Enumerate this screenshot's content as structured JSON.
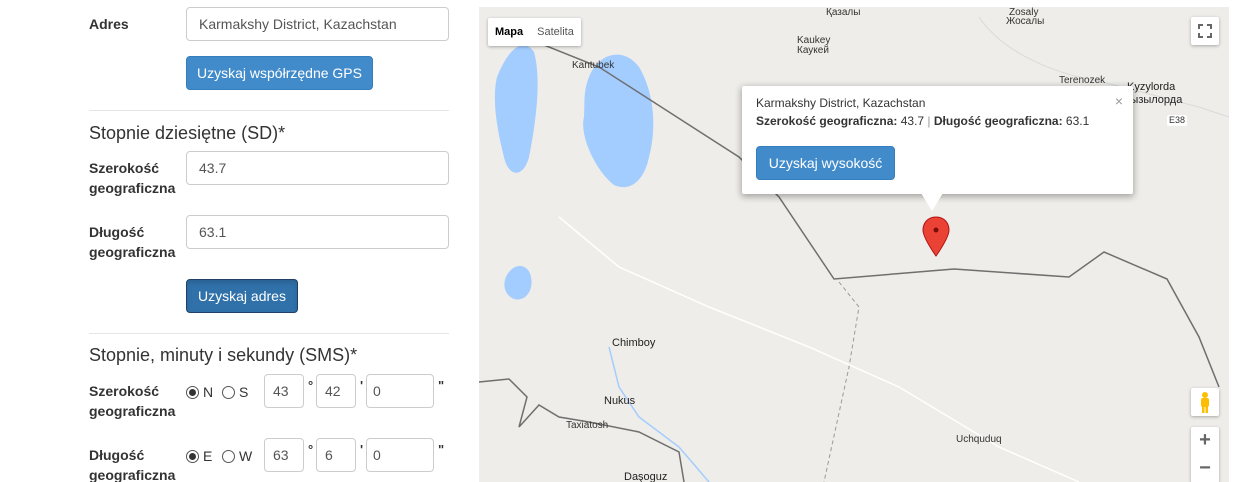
{
  "form": {
    "address_label": "Adres",
    "address_value": "Karmakshy District, Kazachstan",
    "get_gps_button": "Uzyskaj współrzędne GPS",
    "dd_heading": "Stopnie dziesiętne (SD)*",
    "lat_label": "Szerokość geograficzna",
    "lat_value": "43.7",
    "lng_label": "Długość geograficzna",
    "lng_value": "63.1",
    "get_address_button": "Uzyskaj adres",
    "dms_heading": "Stopnie, minuty i sekundy (SMS)*",
    "dms_lat_label": "Szerokość geograficzna",
    "dms_lat_dir_n": "N",
    "dms_lat_dir_s": "S",
    "dms_lat_selected": "N",
    "dms_lat_deg": "43",
    "dms_lat_min": "42",
    "dms_lat_sec": "0",
    "dms_lng_label": "Długość geograficzna",
    "dms_lng_dir_e": "E",
    "dms_lng_dir_w": "W",
    "dms_lng_selected": "E",
    "dms_lng_deg": "63",
    "dms_lng_min": "6",
    "dms_lng_sec": "0",
    "deg_symbol": "°",
    "min_symbol": "'",
    "sec_symbol": "\""
  },
  "map": {
    "type_map": "Mapa",
    "type_satellite": "Satelita",
    "zoom_in": "+",
    "zoom_out": "−",
    "places": {
      "kazaly": "Қазалы",
      "zosaly": "Zosaly",
      "zhosaly": "Жосалы",
      "kaukey": "Kaukey",
      "kaukey_cyr": "Каукей",
      "kantubek": "Kantubek",
      "terenozek": "Terenozek",
      "kyzylorda": "Kyzylorda",
      "kyzylorda_cyr": "Кызылорда",
      "e38": "E38",
      "chimboy": "Chimboy",
      "nukus": "Nukus",
      "taxiatosh": "Taxiatosh",
      "uchquduq": "Uchquduq",
      "dashoguz": "Daşoguz"
    },
    "info": {
      "place": "Karmakshy District, Kazachstan",
      "lat_label": "Szerokość geograficzna:",
      "lat_value": "43.7",
      "separator": "|",
      "lng_label": "Długość geograficzna:",
      "lng_value": "63.1",
      "button": "Uzyskaj wysokość",
      "close": "×"
    },
    "colors": {
      "water": "#a3ccff",
      "border": "#6f6f6f",
      "marker": "#ea4335"
    }
  }
}
